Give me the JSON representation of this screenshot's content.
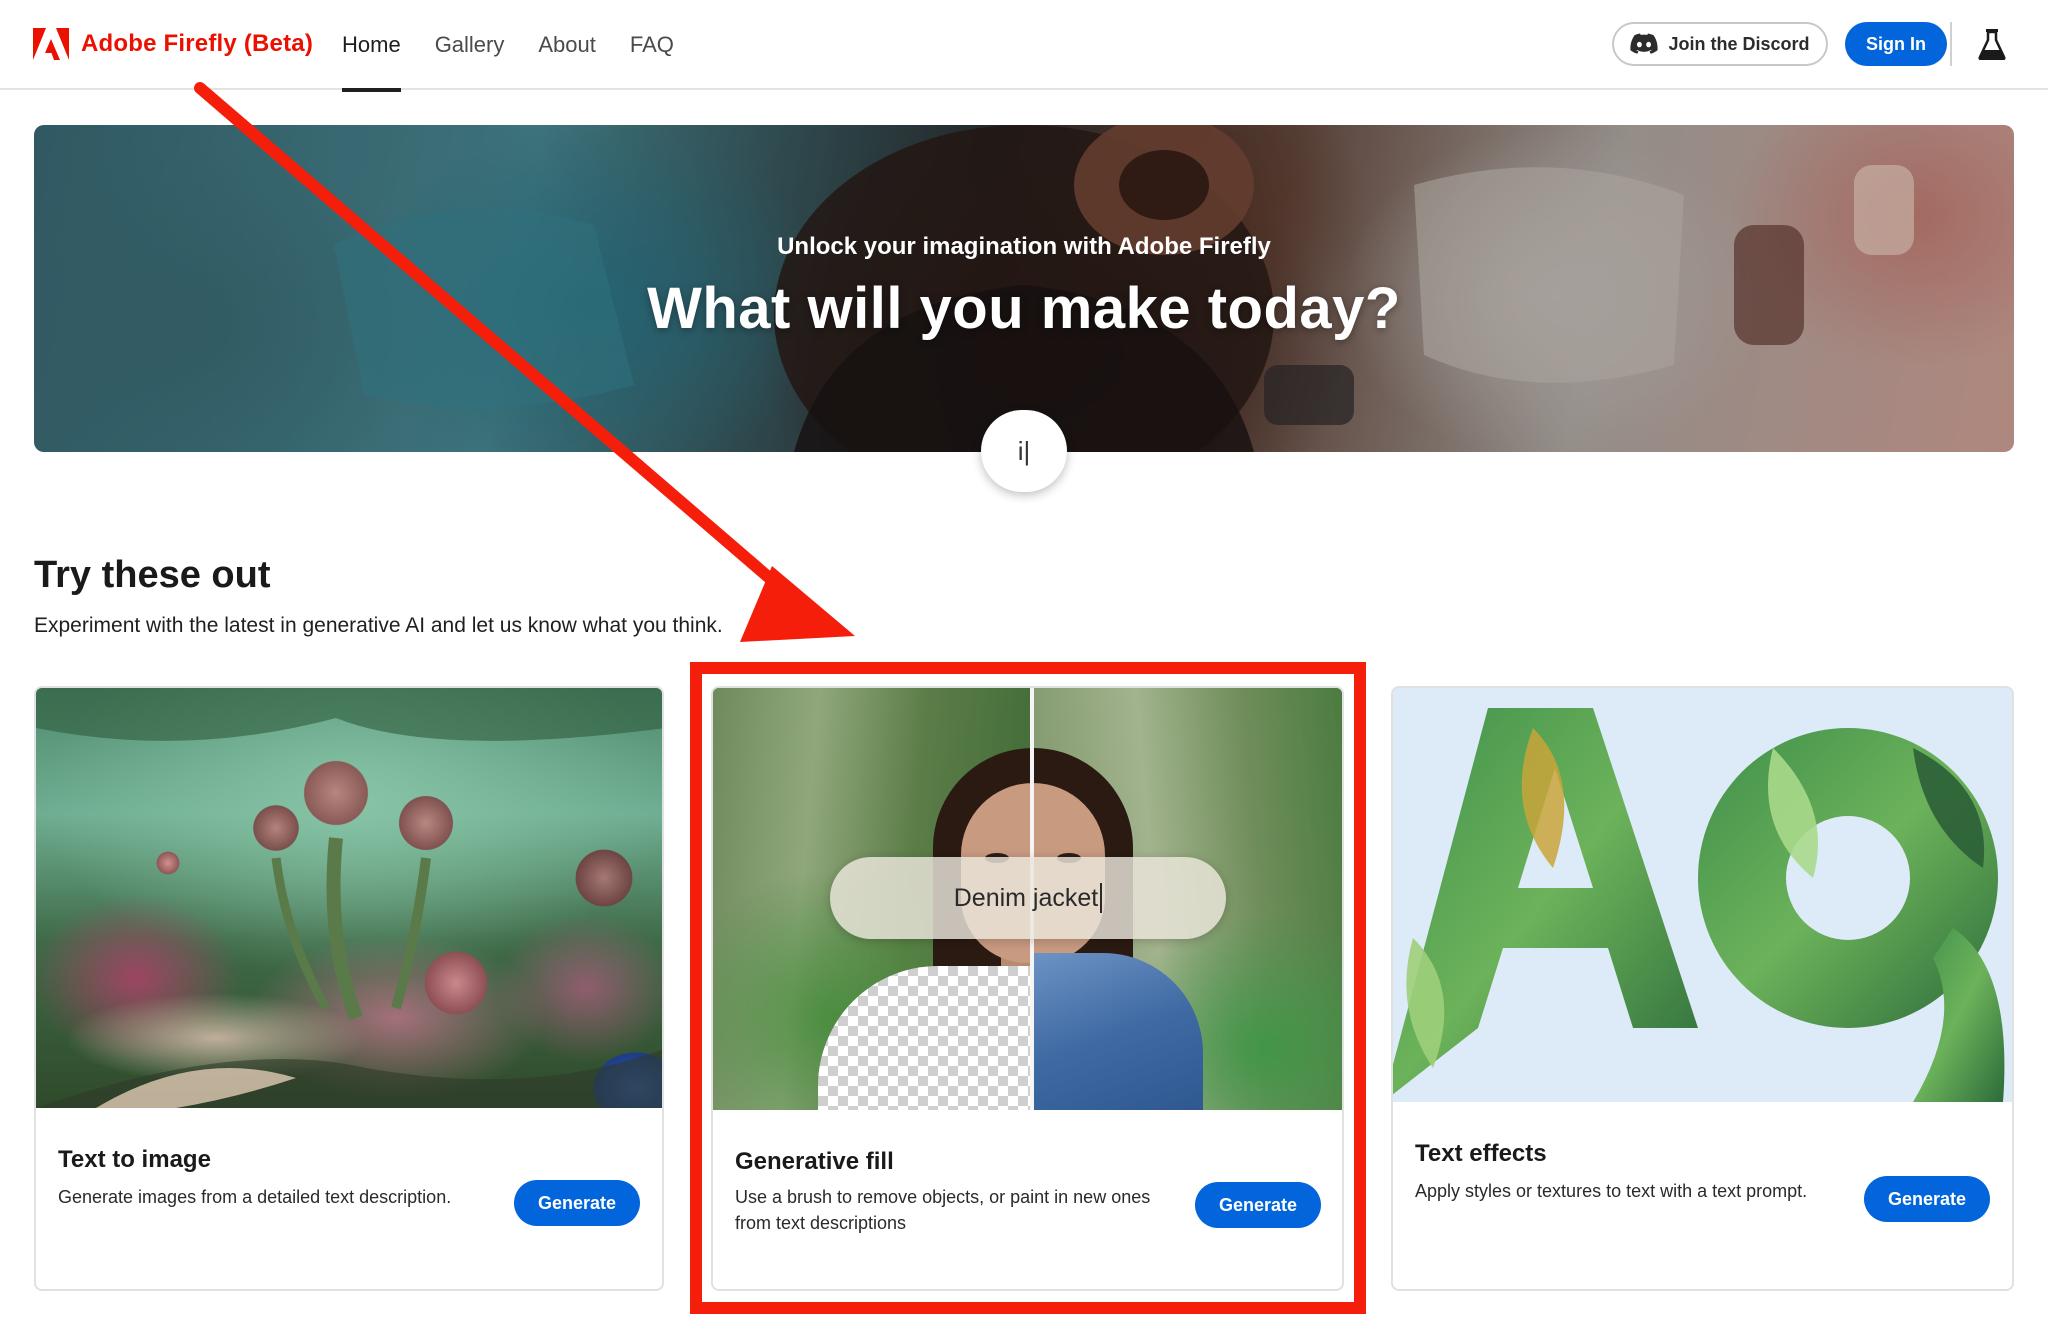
{
  "header": {
    "brand": "Adobe Firefly (Beta)",
    "nav": [
      {
        "label": "Home",
        "active": true
      },
      {
        "label": "Gallery",
        "active": false
      },
      {
        "label": "About",
        "active": false
      },
      {
        "label": "FAQ",
        "active": false
      }
    ],
    "discord_label": "Join the Discord",
    "signin_label": "Sign In",
    "icons": {
      "logo": "adobe-logo",
      "discord": "discord-icon",
      "labs": "flask-icon"
    }
  },
  "hero": {
    "subtitle": "Unlock your imagination with Adobe Firefly",
    "title": "What will you make today?",
    "prompt_text": "i|"
  },
  "section": {
    "title": "Try these out",
    "description": "Experiment with the latest in generative AI and let us know what you think."
  },
  "cards": [
    {
      "title": "Text to image",
      "description": "Generate images from a detailed text description.",
      "button": "Generate"
    },
    {
      "title": "Generative fill",
      "description": "Use a brush to remove objects, or paint in new ones from text descriptions",
      "button": "Generate",
      "prompt": "Denim jacket"
    },
    {
      "title": "Text effects",
      "description": "Apply styles or textures to text with a text prompt.",
      "button": "Generate"
    }
  ],
  "colors": {
    "brand_red": "#eb1000",
    "primary_blue": "#0265dc",
    "annotation_red": "#f51e0a"
  }
}
